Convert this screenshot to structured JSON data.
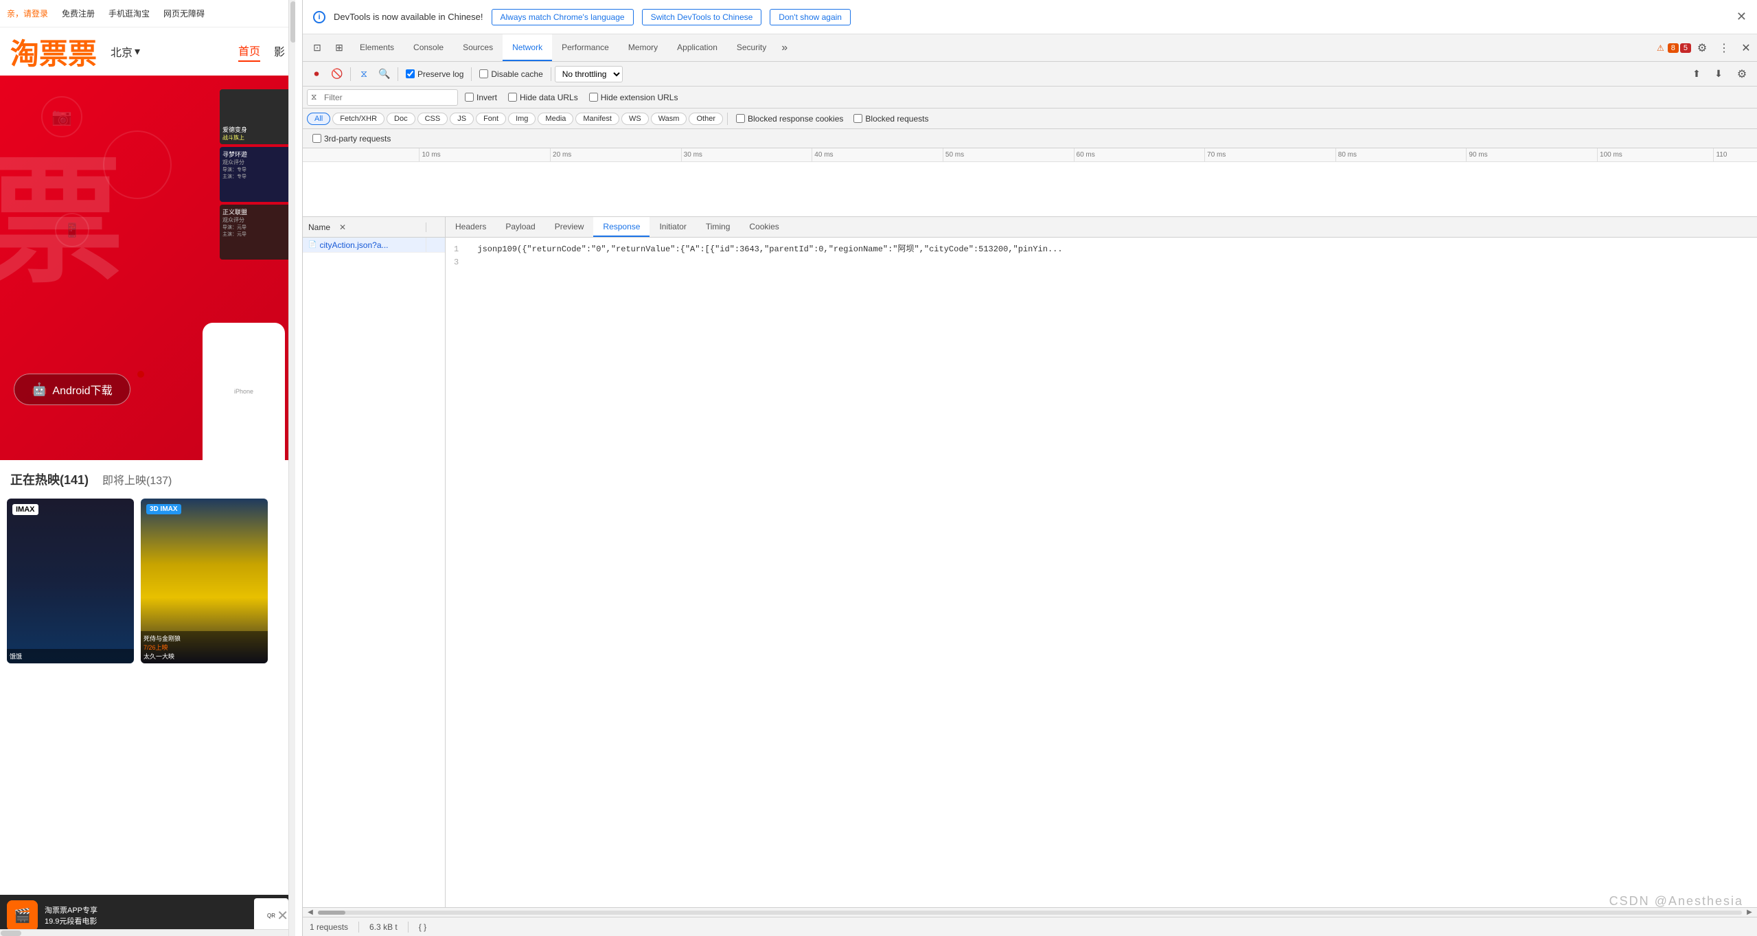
{
  "website": {
    "topbar": {
      "login": "亲，请登录",
      "register": "免费注册",
      "mobile": "手机逛淘宝",
      "accessibility": "网页无障碍"
    },
    "logo": "淘票票",
    "city": "北京",
    "nav": {
      "home": "首页",
      "active": "首页"
    },
    "hero_text": "票",
    "android_btn": "Android下载",
    "section": {
      "hot": "正在热映(141)",
      "upcoming": "即将上映(137)"
    },
    "banner": {
      "title": "淘票票APP专享",
      "subtitle": "19.9元段看电影"
    }
  },
  "devtools": {
    "notification": {
      "text": "DevTools is now available in Chinese!",
      "btn1": "Always match Chrome's language",
      "btn2": "Switch DevTools to Chinese",
      "btn3": "Don't show again"
    },
    "tabs": [
      "Elements",
      "Console",
      "Sources",
      "Network",
      "Performance",
      "Memory",
      "Application",
      "Security"
    ],
    "active_tab": "Network",
    "badges": {
      "warning": "8",
      "error": "5"
    },
    "toolbar": {
      "preserve_log": "Preserve log",
      "disable_cache": "Disable cache",
      "throttle": "No throttling"
    },
    "filter": {
      "placeholder": "Filter",
      "invert": "Invert",
      "hide_data_urls": "Hide data URLs",
      "hide_extension_urls": "Hide extension URLs"
    },
    "filter_chips": [
      "All",
      "Fetch/XHR",
      "Doc",
      "CSS",
      "JS",
      "Font",
      "Img",
      "Media",
      "Manifest",
      "WS",
      "Wasm",
      "Other"
    ],
    "active_chip": "All",
    "blocked": {
      "cookies": "Blocked response cookies",
      "requests": "Blocked requests"
    },
    "third_party": "3rd-party requests",
    "timeline_ticks": [
      "10 ms",
      "20 ms",
      "30 ms",
      "40 ms",
      "50 ms",
      "60 ms",
      "70 ms",
      "80 ms",
      "90 ms",
      "100 ms",
      "110"
    ],
    "table_headers": [
      "Name",
      "Headers",
      "Payload",
      "Preview",
      "Response",
      "Initiator",
      "Timing",
      "Cookies"
    ],
    "active_detail_tab": "Response",
    "file": {
      "name": "cityAction.json?a...",
      "icon": "doc"
    },
    "response_lines": [
      {
        "line": "1",
        "content": "jsonp109({\"returnCode\":\"0\",\"returnValue\":{\"A\":[{\"id\":3643,\"parentId\":0,\"regionName\":\"阿坝\",\"cityCode\":513200,\"pinYin..."
      },
      {
        "line": "3",
        "content": ""
      }
    ],
    "statusbar": {
      "requests": "1 requests",
      "size": "6.3 kB t",
      "json_icon": "{ }"
    },
    "watermark": "CSDN @Anesthesia"
  }
}
